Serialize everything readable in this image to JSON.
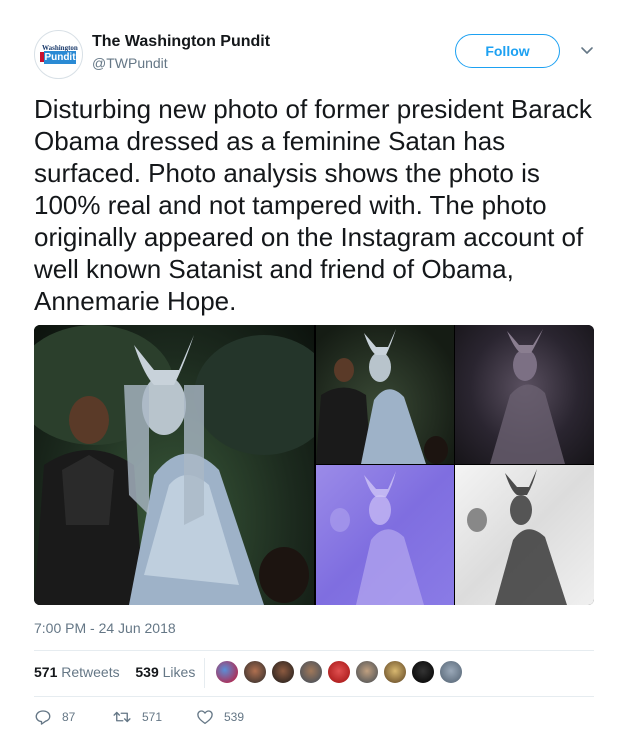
{
  "account": {
    "name": "The Washington Pundit",
    "handle": "@TWPundit",
    "logo_top": "Washington",
    "logo_word": "Pundit"
  },
  "follow_label": "Follow",
  "tweet": {
    "text": "Disturbing new photo of former president Barack Obama dressed as a feminine Satan has surfaced. Photo analysis shows the photo is 100% real and not tampered with. The photo originally appeared on the Instagram account of well known Satanist and friend of Obama, Annemarie Hope."
  },
  "timestamp": "7:00 PM - 24 Jun 2018",
  "stats": {
    "retweets_count": "571",
    "retweets_label": "Retweets",
    "likes_count": "539",
    "likes_label": "Likes"
  },
  "actions": {
    "replies": "87",
    "retweets": "571",
    "likes": "539"
  },
  "colors": {
    "accent": "#1da1f2",
    "muted": "#657786",
    "text": "#14171a"
  },
  "icons": {
    "reply": "reply-icon",
    "retweet": "retweet-icon",
    "like": "heart-icon",
    "caret": "chevron-down-icon"
  }
}
